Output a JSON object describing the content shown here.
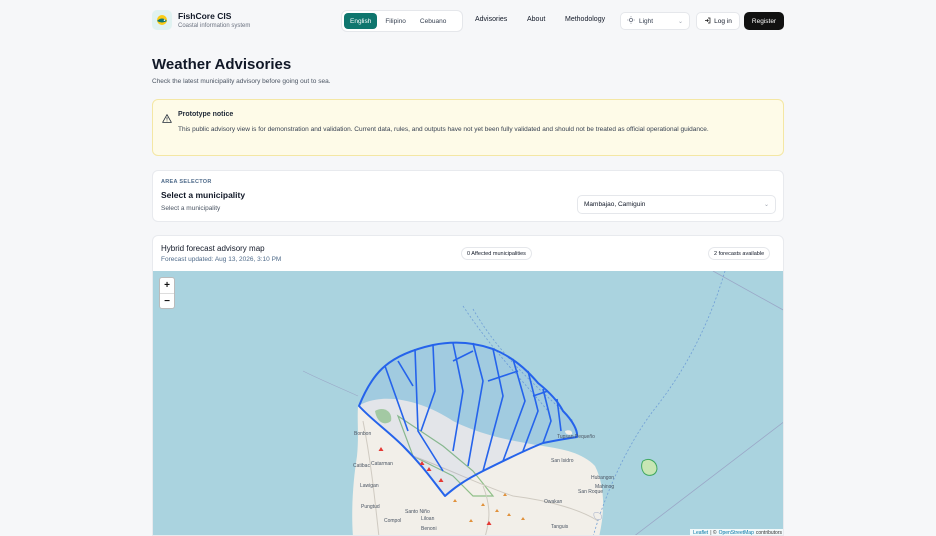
{
  "brand": {
    "name": "FishCore CIS",
    "subtitle": "Coastal information system",
    "logo_icon": "fish-logo-icon"
  },
  "languages": [
    {
      "label": "English",
      "active": true
    },
    {
      "label": "Filipino",
      "active": false
    },
    {
      "label": "Cebuano",
      "active": false
    }
  ],
  "nav": {
    "advisories": "Advisories",
    "about": "About",
    "methodology": "Methodology"
  },
  "theme": {
    "selected": "Light",
    "icon": "sun-icon"
  },
  "auth": {
    "login": "Log in",
    "register": "Register"
  },
  "page": {
    "title": "Weather Advisories",
    "subtitle": "Check the latest municipality advisory before going out to sea."
  },
  "notice": {
    "title": "Prototype notice",
    "body": "This public advisory view is for demonstration and validation. Current data, rules, and outputs have not yet been fully validated and should not be treated as official operational guidance.",
    "icon": "warning-icon"
  },
  "area_selector": {
    "kicker": "AREA SELECTOR",
    "title": "Select a municipality",
    "subtitle": "Select a municipality",
    "selected": "Mambajao, Camiguin"
  },
  "map_card": {
    "title": "Hybrid forecast advisory map",
    "updated": "Forecast updated: Aug 13, 2026, 3:10 PM",
    "affected_badge": "0 Affected municipalities",
    "forecasts_badge": "2 forecasts available",
    "zoom_in": "+",
    "zoom_out": "−",
    "attribution_leaflet": "Leaflet",
    "attribution_sep": "| ©",
    "attribution_osm": "OpenStreetMap",
    "attribution_tail": "contributors"
  },
  "places": {
    "bonbon": "Bonbon",
    "catarman": "Catarman",
    "catibac": "Catibac",
    "lawigan": "Lawigan",
    "pungtud": "Pungtud",
    "tupsan": "Tupsan Pequeño",
    "san_isidro": "San Isidro",
    "mahinog": "Mahinog",
    "hubangon": "Hubangon",
    "san_roque": "San Roque",
    "owakan": "Owakan",
    "santo_nino": "Santo Niño",
    "liloan": "Liloan",
    "compol": "Compol",
    "benoni": "Benoni",
    "tanguis": "Tanguis"
  },
  "colors": {
    "accent": "#0f766e",
    "advisory_outline": "#2563eb",
    "sea": "#aad3df",
    "land": "#f2efe9"
  }
}
